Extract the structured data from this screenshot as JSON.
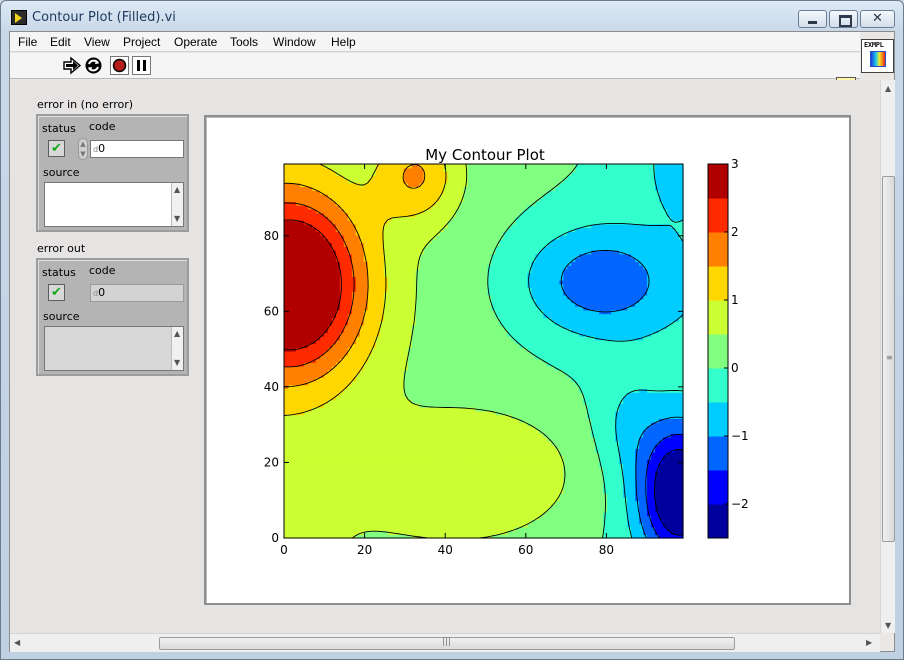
{
  "window": {
    "title": "Contour Plot (Filled).vi"
  },
  "menu": [
    "File",
    "Edit",
    "View",
    "Project",
    "Operate",
    "Tools",
    "Window",
    "Help"
  ],
  "toolbar": {
    "icon_text": "EXMPL",
    "help_glyph": "?"
  },
  "error_in": {
    "label": "error in (no error)",
    "status_label": "status",
    "code_label": "code",
    "code_value": "0",
    "code_prefix": "d",
    "source_label": "source",
    "source_value": ""
  },
  "error_out": {
    "label": "error out",
    "status_label": "status",
    "code_label": "code",
    "code_value": "0",
    "code_prefix": "d",
    "source_label": "source",
    "source_value": ""
  },
  "chart_data": {
    "type": "heatmap",
    "title": "My Contour Plot",
    "xlabel": "",
    "ylabel": "",
    "xlim": [
      0,
      99
    ],
    "ylim": [
      0,
      99
    ],
    "x_ticks": [
      0,
      20,
      40,
      60,
      80
    ],
    "y_ticks": [
      0,
      20,
      40,
      60,
      80
    ],
    "levels": [
      -2.5,
      -2.0,
      -1.5,
      -1.0,
      -0.5,
      0.0,
      0.5,
      1.0,
      1.5,
      2.0,
      2.5,
      3.0
    ],
    "colorbar_ticks": [
      "3",
      "2",
      "1",
      "0",
      "−1",
      "−2"
    ],
    "colorbar_colors": [
      "#00009c",
      "#0000ff",
      "#0066ff",
      "#00ccff",
      "#33ffcc",
      "#80ff80",
      "#ccff33",
      "#ffd700",
      "#ff8000",
      "#ff2a00",
      "#b00000"
    ],
    "negative_contours_dashed": true,
    "grid": false
  }
}
